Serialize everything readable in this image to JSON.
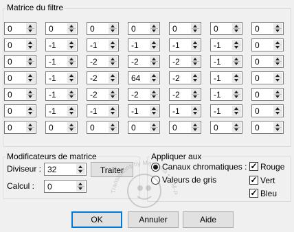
{
  "matrix_group": {
    "title": "Matrice du filtre"
  },
  "matrix": [
    [
      "0",
      "0",
      "0",
      "0",
      "0",
      "0",
      "0"
    ],
    [
      "0",
      "-1",
      "-1",
      "-1",
      "-1",
      "-1",
      "0"
    ],
    [
      "0",
      "-1",
      "-2",
      "-2",
      "-2",
      "-1",
      "0"
    ],
    [
      "0",
      "-1",
      "-2",
      "64",
      "-2",
      "-1",
      "0"
    ],
    [
      "0",
      "-1",
      "-2",
      "-2",
      "-2",
      "-1",
      "0"
    ],
    [
      "0",
      "-1",
      "-1",
      "-1",
      "-1",
      "-1",
      "0"
    ],
    [
      "0",
      "0",
      "0",
      "0",
      "0",
      "0",
      "0"
    ]
  ],
  "modifiers": {
    "title": "Modificateurs de matrice",
    "divisor_label": "Diviseur :",
    "divisor_value": "32",
    "process_button": "Traiter",
    "calc_label": "Calcul :",
    "calc_value": "0"
  },
  "apply": {
    "title": "Appliquer aux",
    "chromatic_label": "Canaux chromatiques :",
    "gray_label": "Valeurs de gris",
    "red_label": "Rouge",
    "green_label": "Vert",
    "blue_label": "Bleu"
  },
  "buttons": {
    "ok": "OK",
    "cancel": "Annuler",
    "help": "Aide"
  },
  "watermark_text": "Translations by Marcinha • SIM-PSP"
}
